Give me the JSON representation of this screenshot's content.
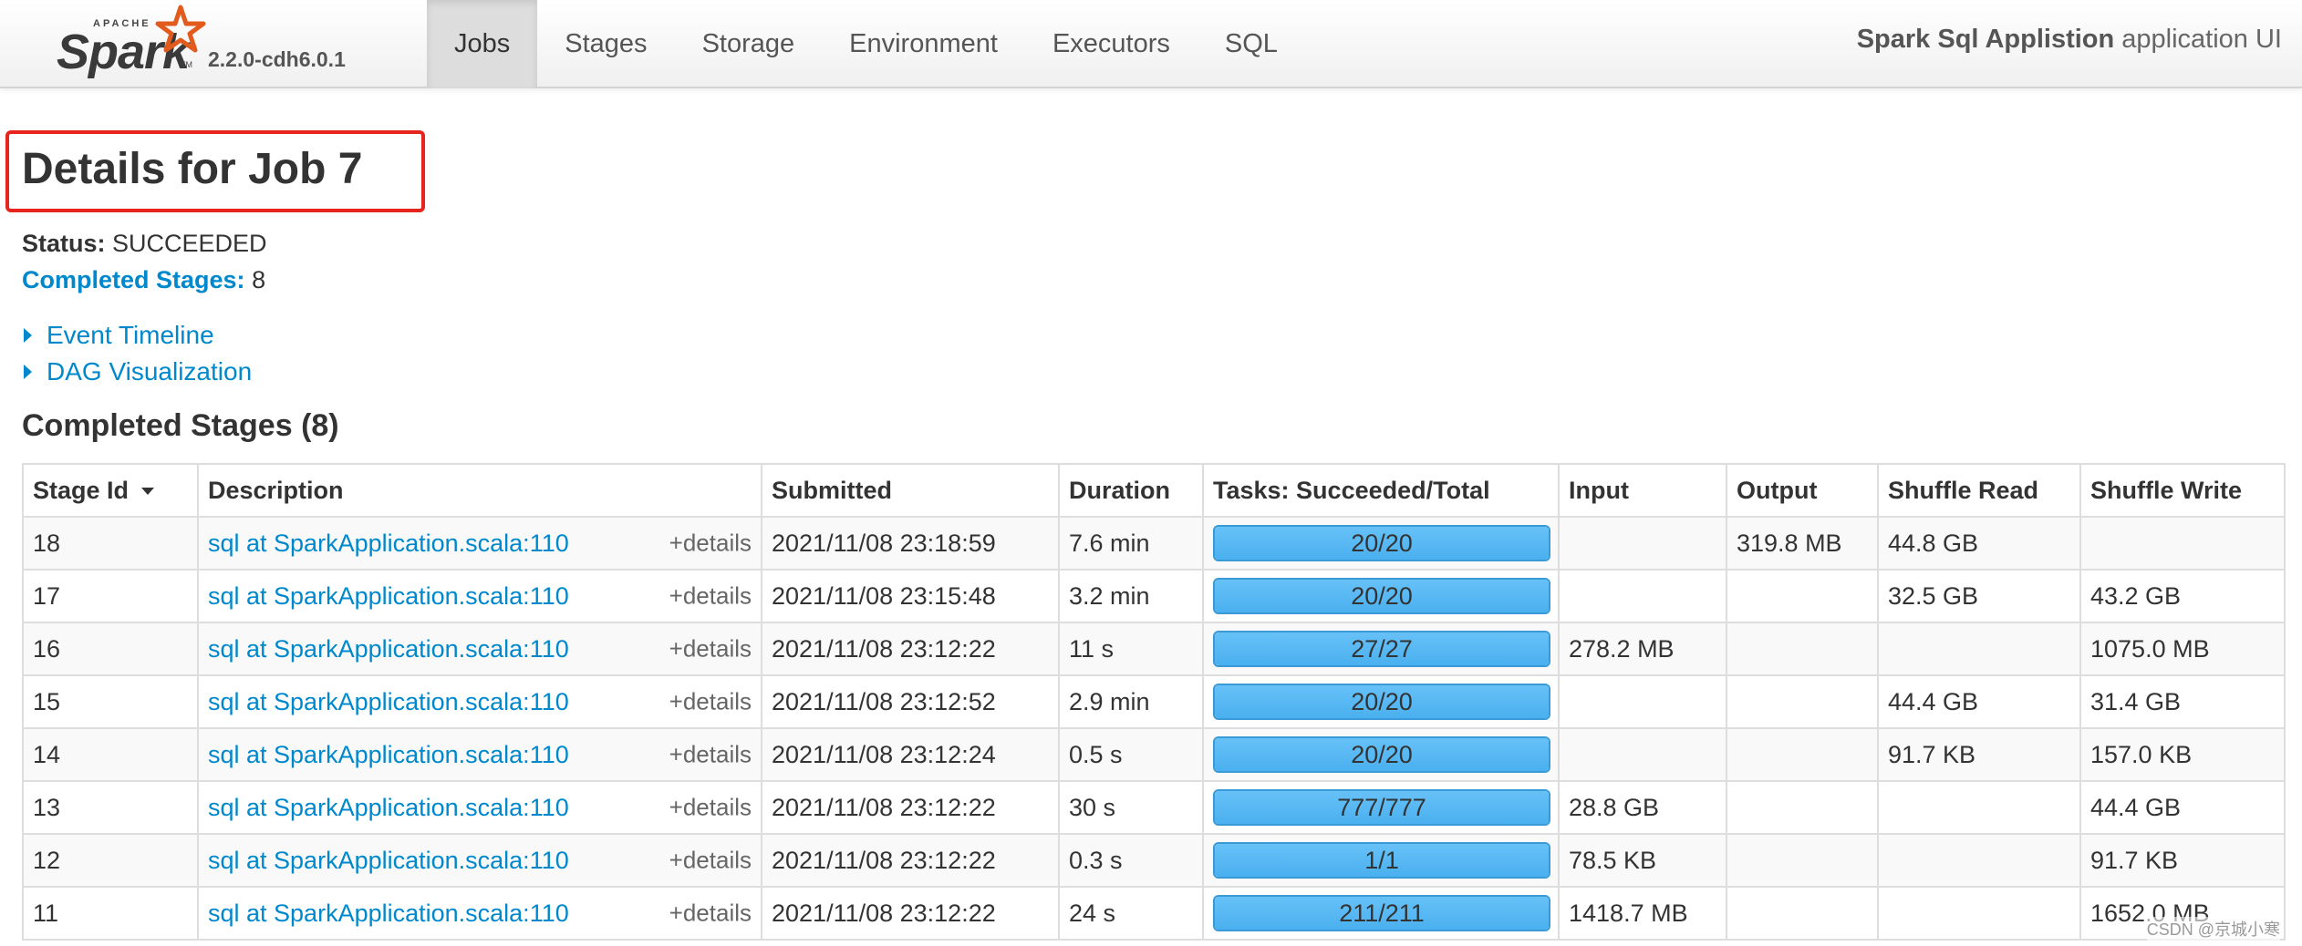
{
  "navbar": {
    "logo_apache": "APACHE",
    "logo_spark": "Spark",
    "logo_tm": "TM",
    "version": "2.2.0-cdh6.0.1",
    "tabs": [
      {
        "label": "Jobs",
        "active": true
      },
      {
        "label": "Stages",
        "active": false
      },
      {
        "label": "Storage",
        "active": false
      },
      {
        "label": "Environment",
        "active": false
      },
      {
        "label": "Executors",
        "active": false
      },
      {
        "label": "SQL",
        "active": false
      }
    ],
    "app_name": "Spark Sql Applistion",
    "app_suffix": " application UI"
  },
  "page": {
    "title": "Details for Job 7",
    "status_label": "Status:",
    "status_value": "SUCCEEDED",
    "completed_label": "Completed Stages:",
    "completed_value": "8",
    "event_timeline": "Event Timeline",
    "dag_visualization": "DAG Visualization",
    "section_title": "Completed Stages (8)"
  },
  "table": {
    "headers": [
      "Stage Id",
      "Description",
      "Submitted",
      "Duration",
      "Tasks: Succeeded/Total",
      "Input",
      "Output",
      "Shuffle Read",
      "Shuffle Write"
    ],
    "details_label": "+details",
    "rows": [
      {
        "id": "18",
        "desc": "sql at SparkApplication.scala:110",
        "submitted": "2021/11/08 23:18:59",
        "duration": "7.6 min",
        "tasks": "20/20",
        "done": 1.0,
        "input": "",
        "output": "319.8 MB",
        "shuffle_read": "44.8 GB",
        "shuffle_write": ""
      },
      {
        "id": "17",
        "desc": "sql at SparkApplication.scala:110",
        "submitted": "2021/11/08 23:15:48",
        "duration": "3.2 min",
        "tasks": "20/20",
        "done": 1.0,
        "input": "",
        "output": "",
        "shuffle_read": "32.5 GB",
        "shuffle_write": "43.2 GB"
      },
      {
        "id": "16",
        "desc": "sql at SparkApplication.scala:110",
        "submitted": "2021/11/08 23:12:22",
        "duration": "11 s",
        "tasks": "27/27",
        "done": 1.0,
        "input": "278.2 MB",
        "output": "",
        "shuffle_read": "",
        "shuffle_write": "1075.0 MB"
      },
      {
        "id": "15",
        "desc": "sql at SparkApplication.scala:110",
        "submitted": "2021/11/08 23:12:52",
        "duration": "2.9 min",
        "tasks": "20/20",
        "done": 1.0,
        "input": "",
        "output": "",
        "shuffle_read": "44.4 GB",
        "shuffle_write": "31.4 GB"
      },
      {
        "id": "14",
        "desc": "sql at SparkApplication.scala:110",
        "submitted": "2021/11/08 23:12:24",
        "duration": "0.5 s",
        "tasks": "20/20",
        "done": 1.0,
        "input": "",
        "output": "",
        "shuffle_read": "91.7 KB",
        "shuffle_write": "157.0 KB"
      },
      {
        "id": "13",
        "desc": "sql at SparkApplication.scala:110",
        "submitted": "2021/11/08 23:12:22",
        "duration": "30 s",
        "tasks": "777/777",
        "done": 1.0,
        "input": "28.8 GB",
        "output": "",
        "shuffle_read": "",
        "shuffle_write": "44.4 GB"
      },
      {
        "id": "12",
        "desc": "sql at SparkApplication.scala:110",
        "submitted": "2021/11/08 23:12:22",
        "duration": "0.3 s",
        "tasks": "1/1",
        "done": 1.0,
        "input": "78.5 KB",
        "output": "",
        "shuffle_read": "",
        "shuffle_write": "91.7 KB"
      },
      {
        "id": "11",
        "desc": "sql at SparkApplication.scala:110",
        "submitted": "2021/11/08 23:12:22",
        "duration": "24 s",
        "tasks": "211/211",
        "done": 1.0,
        "input": "1418.7 MB",
        "output": "",
        "shuffle_read": "",
        "shuffle_write": "1652.0 MB"
      }
    ]
  },
  "watermark": "CSDN @京城小寒",
  "colors": {
    "link": "#0088cc",
    "progress": "#4ab0ef",
    "highlight_box": "#e8241f",
    "logo_star": "#e25a1c"
  },
  "icons": {
    "logo_star": "star-icon",
    "sort": "sort-desc-icon",
    "expand": "triangle-right-icon"
  }
}
